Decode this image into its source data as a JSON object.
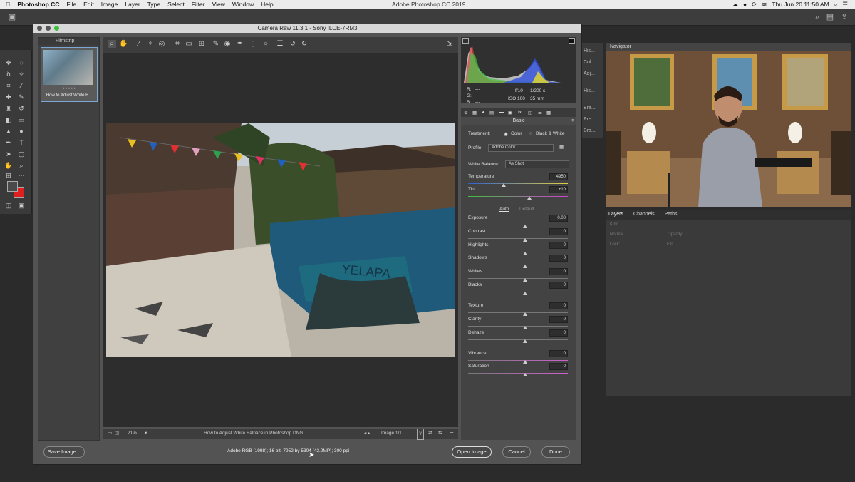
{
  "menubar": {
    "app": "Photoshop CC",
    "items": [
      "File",
      "Edit",
      "Image",
      "Layer",
      "Type",
      "Select",
      "Filter",
      "View",
      "Window",
      "Help"
    ],
    "center_title": "Adobe Photoshop CC 2019",
    "clock": "Thu Jun 20  11:50 AM"
  },
  "dialog": {
    "title": "Camera Raw 11.3.1  -  Sony ILCE-7RM3",
    "filmstrip_label": "Filmstrip",
    "thumb_caption": "How to Adjust White B...",
    "thumb_rating": "• • • • •",
    "zoom": "21%",
    "filename": "How to Adjust White Balnace in Photoshop.DNG",
    "image_count": "Image 1/1",
    "exif": {
      "r": "R:",
      "g": "G:",
      "b": "B:",
      "dash": "---",
      "aperture": "f/10",
      "shutter": "1/200 s",
      "iso": "ISO 100",
      "focal": "35 mm"
    },
    "panel_title": "Basic",
    "treatment_label": "Treatment:",
    "treatment_color": "Color",
    "treatment_bw": "Black & White",
    "profile_label": "Profile:",
    "profile_value": "Adobe Color",
    "wb_label": "White Balance:",
    "wb_value": "As Shot",
    "auto": "Auto",
    "default": "Default",
    "sliders": [
      {
        "label": "Temperature",
        "value": "4950"
      },
      {
        "label": "Tint",
        "value": "+10"
      },
      {
        "label": "Exposure",
        "value": "0.00"
      },
      {
        "label": "Contrast",
        "value": "0"
      },
      {
        "label": "Highlights",
        "value": "0"
      },
      {
        "label": "Shadows",
        "value": "0"
      },
      {
        "label": "Whites",
        "value": "0"
      },
      {
        "label": "Blacks",
        "value": "0"
      },
      {
        "label": "Texture",
        "value": "0"
      },
      {
        "label": "Clarity",
        "value": "0"
      },
      {
        "label": "Dehaze",
        "value": "0"
      },
      {
        "label": "Vibrance",
        "value": "0"
      },
      {
        "label": "Saturation",
        "value": "0"
      }
    ],
    "save_label": "Save Image...",
    "info_link": "Adobe RGB (1998); 16 bit; 7952 by 5304 (42.2MP); 300 ppi",
    "open_label": "Open Image",
    "cancel_label": "Cancel",
    "done_label": "Done"
  },
  "dock": [
    "His...",
    "Col...",
    "Adj...",
    "His...",
    "Bra...",
    "Pre...",
    "Bra..."
  ],
  "navigator": {
    "title": "Navigator"
  },
  "layers": {
    "tabs": [
      "Layers",
      "Channels",
      "Paths"
    ],
    "kind": "Kind",
    "normal": "Normal",
    "opacity": "Opacity:",
    "lock": "Lock:",
    "fill": "Fill:"
  },
  "photo": {
    "painted_text": "YELAPA"
  },
  "colors": {
    "accent": "#7aa7d6",
    "bg_color": "#e02020"
  }
}
